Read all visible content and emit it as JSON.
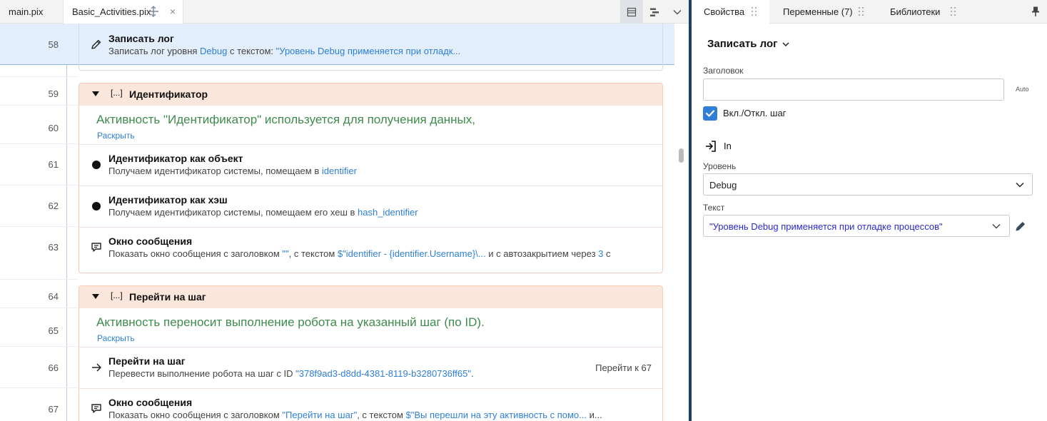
{
  "tabs": [
    {
      "label": "main.pix"
    },
    {
      "label": "Basic_Activities.pix",
      "close": "×"
    }
  ],
  "rows": {
    "r58": {
      "num": "58",
      "title": "Записать лог",
      "desc_a": "Записать лог уровня ",
      "desc_b": "Debug",
      "desc_c": " с текстом: ",
      "desc_d": "\"Уровень Debug применяется при отладк..."
    },
    "g1": {
      "num": "59",
      "bracket": "[...]",
      "title": "Идентификатор"
    },
    "c60": {
      "num": "60",
      "text": "Активность \"Идентификатор\" используется для получения данных,",
      "expand": "Раскрыть"
    },
    "r61": {
      "num": "61",
      "title": "Идентификатор как объект",
      "desc_a": "Получаем идентификатор системы, помещаем в ",
      "desc_b": "identifier"
    },
    "r62": {
      "num": "62",
      "title": "Идентификатор как хэш",
      "desc_a": "Получаем идентификатор системы, помещаем его хеш в ",
      "desc_b": "hash_identifier"
    },
    "r63": {
      "num": "63",
      "title": "Окно сообщения",
      "desc_a": "Показать окно сообщения с заголовком ",
      "desc_b": "\"\"",
      "desc_c": ", с текстом ",
      "desc_d": "$\"identifier - {identifier.Username}\\...",
      "desc_e": " и с автозакрытием через ",
      "desc_f": "3",
      "desc_g": " с"
    },
    "g2": {
      "num": "64",
      "bracket": "[...]",
      "title": "Перейти на шаг"
    },
    "c65": {
      "num": "65",
      "text": "Активность переносит выполнение робота на указанный шаг (по ID).",
      "expand": "Раскрыть"
    },
    "r66": {
      "num": "66",
      "title": "Перейти на шаг",
      "desc_a": "Перевести выполнение робота на шаг с ID ",
      "desc_b": "\"378f9ad3-d8dd-4381-8119-b3280736ff65\"",
      "desc_c": ".",
      "right": "Перейти к 67"
    },
    "r67": {
      "num": "67",
      "title": "Окно сообщения",
      "desc_a": "Показать окно сообщения с заголовком ",
      "desc_b": "\"Перейти на шаг\"",
      "desc_c": ", с текстом ",
      "desc_d": "$\"Вы перешли на эту активность с помо...",
      "desc_e": " и..."
    }
  },
  "panel": {
    "tabs": [
      {
        "label": "Свойства"
      },
      {
        "label": "Переменные (7)"
      },
      {
        "label": "Библиотеки"
      }
    ],
    "title": "Записать лог",
    "header_label": "Заголовок",
    "header_value": "",
    "auto_label": "Auto",
    "enable_label": "Вкл./Откл. шаг",
    "enabled": true,
    "in_label": "In",
    "level_label": "Уровень",
    "level_value": "Debug",
    "text_label": "Текст",
    "text_value": "\"Уровень Debug применяется при отладке процессов\""
  },
  "colors": {
    "accent": "#2f7fd8",
    "comment_green": "#3f8a4d",
    "group_header_bg": "#fae6da",
    "selected_row_bg": "#e2eefb",
    "text_value_blue": "#2a2ad0",
    "divider": "#1f3d6b"
  },
  "icons": {
    "pencil": "pencil-icon",
    "dot": "activity-dot-icon",
    "message": "message-icon",
    "arrow": "arrow-right-icon",
    "in": "input-arrow-icon"
  }
}
